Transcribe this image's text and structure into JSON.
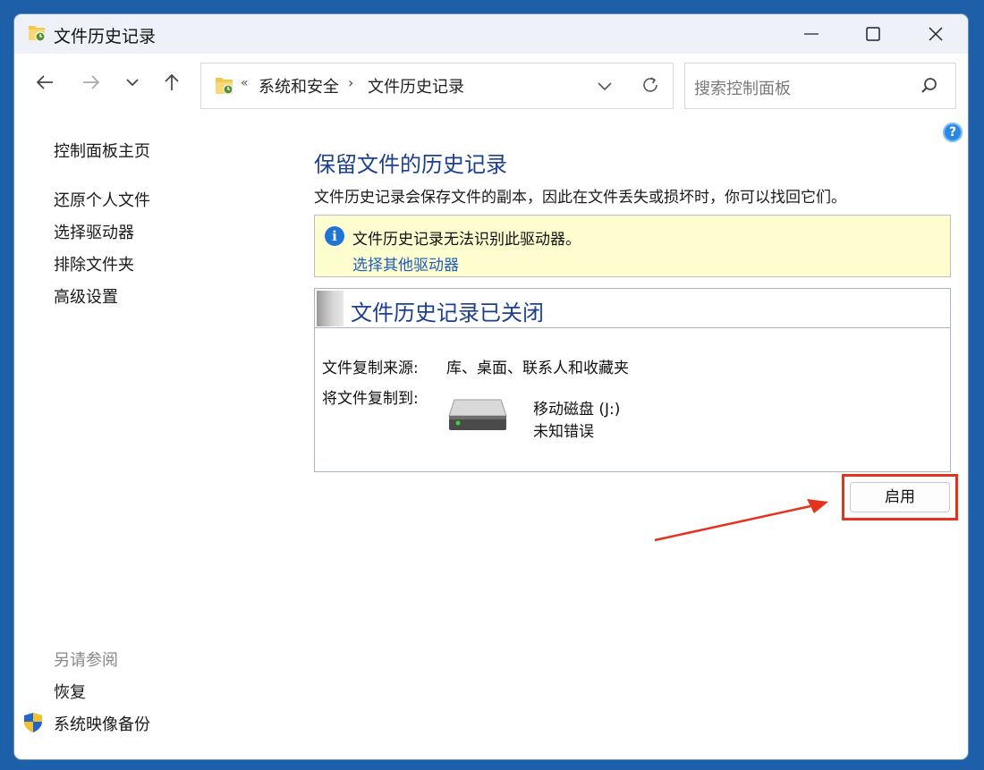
{
  "window": {
    "title": "文件历史记录"
  },
  "address": {
    "overflow": "«",
    "crumbs": [
      "系统和安全",
      "文件历史记录"
    ],
    "separator": "›"
  },
  "search": {
    "placeholder": "搜索控制面板"
  },
  "left_pane": {
    "home": "控制面板主页",
    "links": [
      "还原个人文件",
      "选择驱动器",
      "排除文件夹",
      "高级设置"
    ],
    "see_also_header": "另请参阅",
    "see_also": [
      "恢复",
      "系统映像备份"
    ]
  },
  "help": {
    "label": "?"
  },
  "main": {
    "title": "保留文件的历史记录",
    "description": "文件历史记录会保存文件的副本，因此在文件丢失或损坏时，你可以找回它们。"
  },
  "info_bar": {
    "icon": "i",
    "message": "文件历史记录无法识别此驱动器。",
    "link": "选择其他驱动器"
  },
  "status": {
    "title": "文件历史记录已关闭",
    "source_label": "文件复制来源:",
    "source_value": "库、桌面、联系人和收藏夹",
    "dest_label": "将文件复制到:",
    "drive_name": "移动磁盘 (J:)",
    "drive_status": "未知错误"
  },
  "actions": {
    "enable": "启用"
  },
  "colors": {
    "heading": "#1c3f8f",
    "link": "#1d5fbf",
    "info_bg": "#fefdcf",
    "highlight": "#e5321d"
  }
}
